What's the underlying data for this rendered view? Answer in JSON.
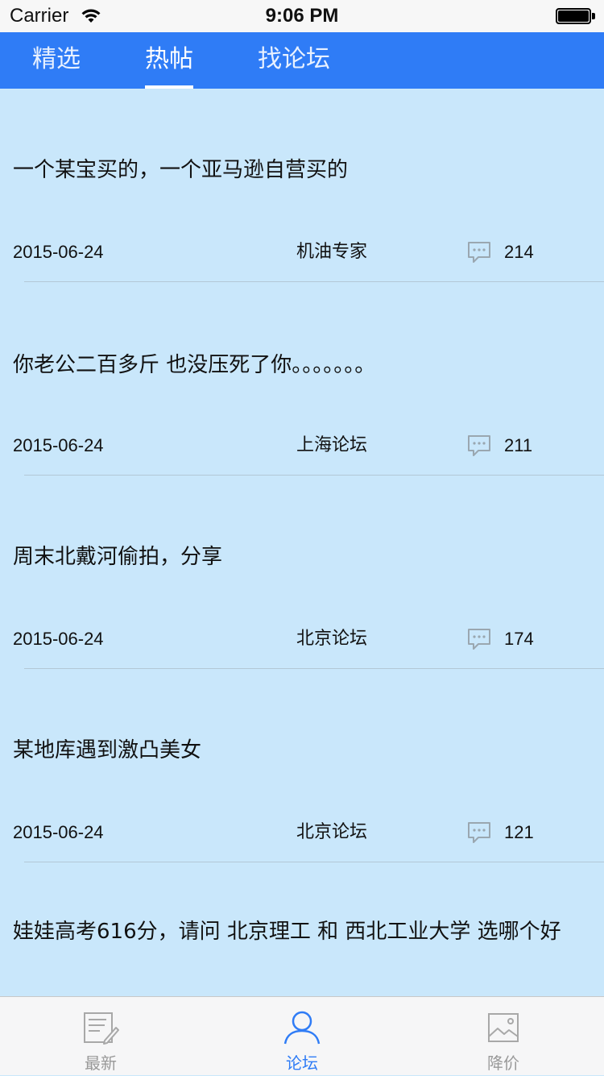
{
  "status_bar": {
    "carrier": "Carrier",
    "time": "9:06 PM",
    "wifi_icon": "wifi-icon",
    "battery_icon": "battery-icon"
  },
  "top_tabs": {
    "active_index": 1,
    "items": [
      {
        "label": "精选"
      },
      {
        "label": "热帖"
      },
      {
        "label": "找论坛"
      }
    ]
  },
  "posts": [
    {
      "title": "一个某宝买的，一个亚马逊自营买的",
      "date": "2015-06-24",
      "forum": "机油专家",
      "comments": "214"
    },
    {
      "title": "你老公二百多斤 也没压死了你。。。。。。。",
      "date": "2015-06-24",
      "forum": "上海论坛",
      "comments": "211"
    },
    {
      "title": "周末北戴河偷拍，分享",
      "date": "2015-06-24",
      "forum": "北京论坛",
      "comments": "174"
    },
    {
      "title": "某地库遇到激凸美女",
      "date": "2015-06-24",
      "forum": "北京论坛",
      "comments": "121"
    },
    {
      "title": "娃娃高考616分，请问 北京理工 和 西北工业大学 选哪个好",
      "date": "",
      "forum": "",
      "comments": ""
    }
  ],
  "bottom_tabs": {
    "active_index": 1,
    "items": [
      {
        "label": "最新",
        "icon": "news-edit-icon"
      },
      {
        "label": "论坛",
        "icon": "person-icon"
      },
      {
        "label": "降价",
        "icon": "image-icon"
      }
    ]
  },
  "colors": {
    "accent": "#2f7cf6",
    "feed_background": "#c9e7fb",
    "inactive_tab": "#999999"
  }
}
